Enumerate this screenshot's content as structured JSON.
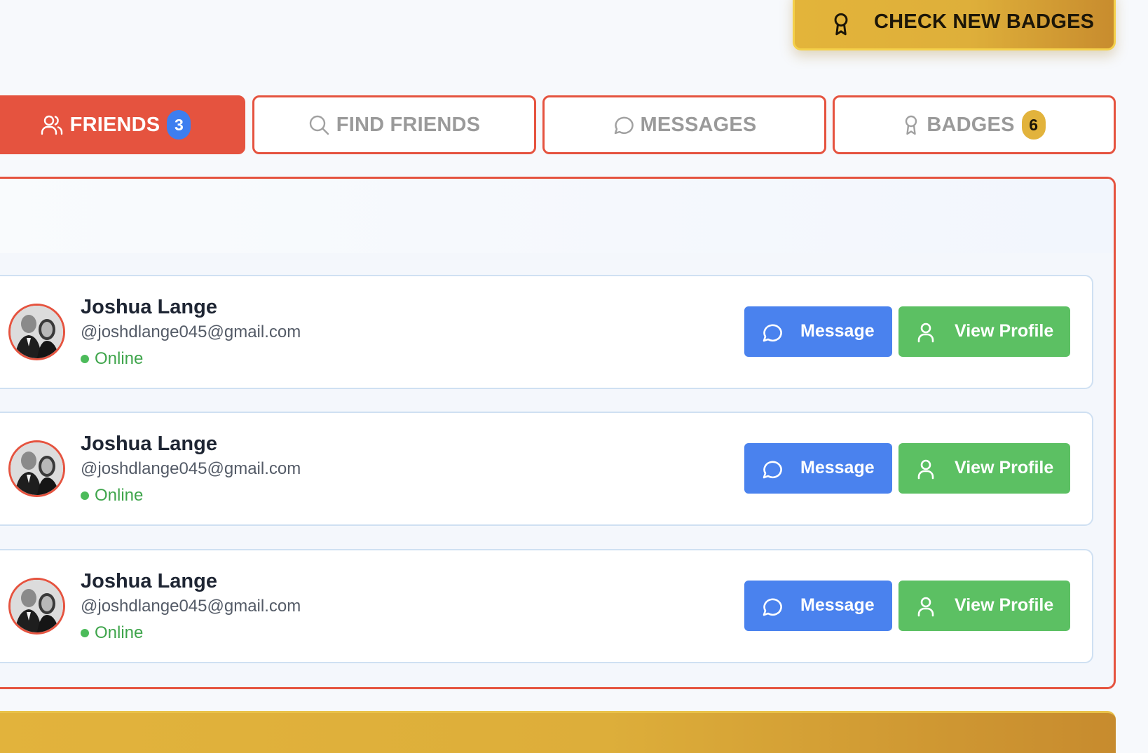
{
  "header": {
    "check_badges_label": "CHECK NEW BADGES"
  },
  "tabs": [
    {
      "label": "FRIENDS",
      "count": "3",
      "icon": "users-icon",
      "active": true
    },
    {
      "label": "FIND FRIENDS",
      "icon": "search-icon",
      "active": false
    },
    {
      "label": "MESSAGES",
      "icon": "message-icon",
      "active": false
    },
    {
      "label": "BADGES",
      "count": "6",
      "icon": "award-icon",
      "active": false
    }
  ],
  "friends": [
    {
      "name": "Joshua Lange",
      "email": "@joshdlange045@gmail.com",
      "status": "Online"
    },
    {
      "name": "Joshua Lange",
      "email": "@joshdlange045@gmail.com",
      "status": "Online"
    },
    {
      "name": "Joshua Lange",
      "email": "@joshdlange045@gmail.com",
      "status": "Online"
    }
  ],
  "actions": {
    "message_label": "Message",
    "view_profile_label": "View Profile"
  },
  "colors": {
    "accent_red": "#e5533f",
    "gold": "#e2b33c",
    "blue": "#4a82ee",
    "green": "#5cc063",
    "online_green": "#3fa54c"
  }
}
